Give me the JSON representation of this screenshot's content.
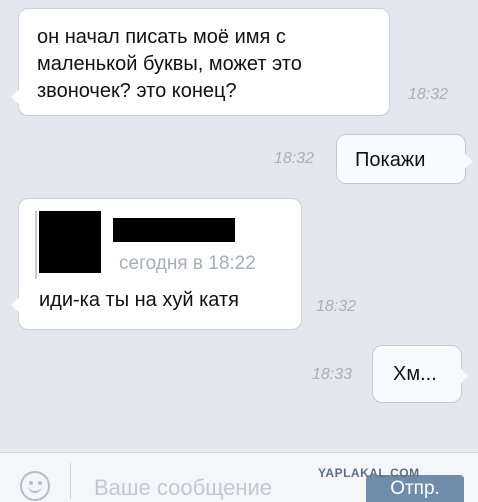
{
  "messages": [
    {
      "direction": "incoming",
      "text": "он начал писать моё имя с маленькой буквы, может это звоночек? это конец?",
      "time": "18:32"
    },
    {
      "direction": "outgoing",
      "text": "Покажи",
      "time": "18:32"
    },
    {
      "direction": "incoming",
      "quote": {
        "time": "сегодня в 18:22"
      },
      "text": "иди-ка ты на хуй катя",
      "time": "18:32"
    },
    {
      "direction": "outgoing",
      "text": "Хм...",
      "time": "18:33"
    }
  ],
  "composer": {
    "placeholder": "Ваше сообщение",
    "send_label": "Отпр."
  },
  "watermark": "YAPLAKAL.COM"
}
